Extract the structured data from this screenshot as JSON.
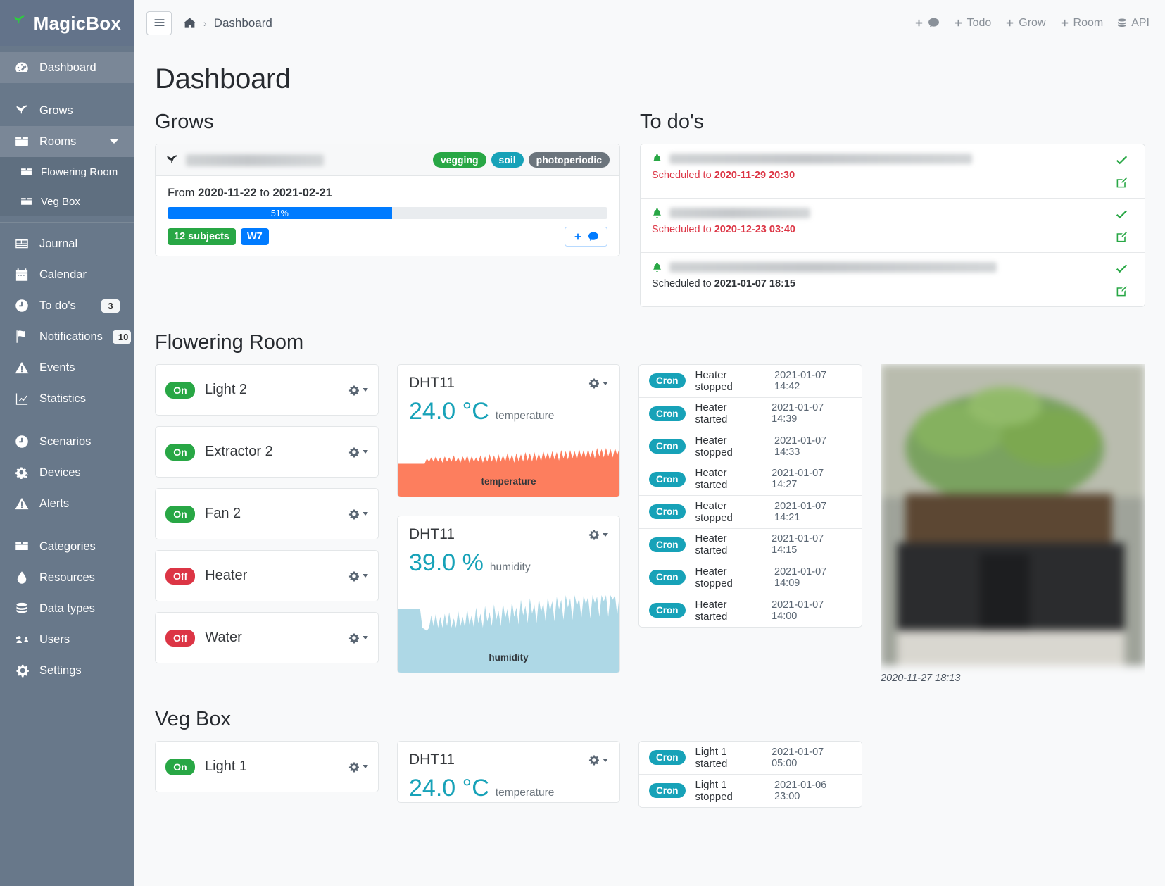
{
  "brand": {
    "name": "MagicBox",
    "logo_icon": "sprout-icon"
  },
  "sidebar": {
    "groups": [
      {
        "items": [
          {
            "label": "Dashboard",
            "icon": "dashboard-icon",
            "active": true
          }
        ]
      },
      {
        "items": [
          {
            "label": "Grows",
            "icon": "sprout-icon"
          },
          {
            "label": "Rooms",
            "icon": "box-icon",
            "expanded": true,
            "children": [
              {
                "label": "Flowering Room",
                "icon": "box-icon"
              },
              {
                "label": "Veg Box",
                "icon": "box-icon"
              }
            ]
          }
        ]
      },
      {
        "items": [
          {
            "label": "Journal",
            "icon": "journal-icon"
          },
          {
            "label": "Calendar",
            "icon": "calendar-icon"
          },
          {
            "label": "To do's",
            "icon": "clock-icon",
            "badge": "3"
          },
          {
            "label": "Notifications",
            "icon": "flag-icon",
            "badge": "10"
          },
          {
            "label": "Events",
            "icon": "warning-icon"
          },
          {
            "label": "Statistics",
            "icon": "chart-line-icon"
          }
        ]
      },
      {
        "items": [
          {
            "label": "Scenarios",
            "icon": "clock-icon"
          },
          {
            "label": "Devices",
            "icon": "cogs-icon"
          },
          {
            "label": "Alerts",
            "icon": "warning-icon"
          }
        ]
      },
      {
        "items": [
          {
            "label": "Categories",
            "icon": "box-icon"
          },
          {
            "label": "Resources",
            "icon": "droplet-icon"
          },
          {
            "label": "Data types",
            "icon": "database-icon"
          },
          {
            "label": "Users",
            "icon": "users-icon"
          },
          {
            "label": "Settings",
            "icon": "gear-icon"
          }
        ]
      }
    ]
  },
  "topbar": {
    "menu_icon": "hamburger-icon",
    "home_icon": "home-icon",
    "separator": "›",
    "breadcrumb": "Dashboard",
    "actions": [
      {
        "label": "",
        "icon": "plus-comment-icon"
      },
      {
        "label": "Todo",
        "icon": "plus-icon"
      },
      {
        "label": "Grow",
        "icon": "plus-icon"
      },
      {
        "label": "Room",
        "icon": "plus-icon"
      },
      {
        "label": "API",
        "icon": "database-icon"
      }
    ]
  },
  "page": {
    "title": "Dashboard"
  },
  "grows": {
    "section_title": "Grows",
    "card": {
      "name_redacted": true,
      "icon": "sprout-icon",
      "tags": [
        {
          "label": "vegging",
          "color": "#28a745"
        },
        {
          "label": "soil",
          "color": "#17a2b8"
        },
        {
          "label": "photoperiodic",
          "color": "#6c757d"
        }
      ],
      "from_label": "From",
      "to_label": "to",
      "date_start": "2020-11-22",
      "date_end": "2021-02-21",
      "progress_percent": 51,
      "progress_label": "51%",
      "subjects_label": "12 subjects",
      "week_label": "W7",
      "action_icons": [
        "plus-icon",
        "comment-icon"
      ]
    }
  },
  "todos": {
    "section_title": "To do's",
    "items": [
      {
        "title_redacted": true,
        "redact_width": 430,
        "scheduled_prefix": "Scheduled to",
        "scheduled_at": "2020-11-29 20:30",
        "overdue": true,
        "icon": "bell-icon",
        "actions": [
          "check-icon",
          "edit-icon"
        ]
      },
      {
        "title_redacted": true,
        "redact_width": 200,
        "scheduled_prefix": "Scheduled to",
        "scheduled_at": "2020-12-23 03:40",
        "overdue": true,
        "icon": "bell-icon",
        "actions": [
          "check-icon",
          "edit-icon"
        ]
      },
      {
        "title_redacted": true,
        "redact_width": 465,
        "scheduled_prefix": "Scheduled to",
        "scheduled_at": "2021-01-07 18:15",
        "overdue": false,
        "icon": "bell-icon",
        "actions": [
          "check-icon",
          "edit-icon"
        ]
      }
    ]
  },
  "rooms": [
    {
      "title": "Flowering Room",
      "devices": [
        {
          "name": "Light 2",
          "state": "On"
        },
        {
          "name": "Extractor 2",
          "state": "On"
        },
        {
          "name": "Fan 2",
          "state": "On"
        },
        {
          "name": "Heater",
          "state": "Off"
        },
        {
          "name": "Water",
          "state": "Off"
        }
      ],
      "sensors": [
        {
          "name": "DHT11",
          "value": "24.0",
          "unit": "°C",
          "metric": "temperature",
          "chart_label": "temperature",
          "color": "#fd7e5e"
        },
        {
          "name": "DHT11",
          "value": "39.0",
          "unit": "%",
          "metric": "humidity",
          "chart_label": "humidity",
          "color": "#aed8e6"
        }
      ],
      "logs": [
        {
          "source": "Cron",
          "message": "Heater stopped",
          "time": "2021-01-07 14:42"
        },
        {
          "source": "Cron",
          "message": "Heater started",
          "time": "2021-01-07 14:39"
        },
        {
          "source": "Cron",
          "message": "Heater stopped",
          "time": "2021-01-07 14:33"
        },
        {
          "source": "Cron",
          "message": "Heater started",
          "time": "2021-01-07 14:27"
        },
        {
          "source": "Cron",
          "message": "Heater stopped",
          "time": "2021-01-07 14:21"
        },
        {
          "source": "Cron",
          "message": "Heater started",
          "time": "2021-01-07 14:15"
        },
        {
          "source": "Cron",
          "message": "Heater stopped",
          "time": "2021-01-07 14:09"
        },
        {
          "source": "Cron",
          "message": "Heater started",
          "time": "2021-01-07 14:00"
        }
      ],
      "photo": {
        "caption": "2020-11-27 18:13",
        "alt": "plant-photo"
      }
    },
    {
      "title": "Veg Box",
      "devices": [
        {
          "name": "Light 1",
          "state": "On"
        }
      ],
      "sensors": [
        {
          "name": "DHT11",
          "value": "24.0",
          "unit": "°C",
          "metric": "temperature",
          "chart_label": "temperature",
          "color": "#fd7e5e"
        }
      ],
      "logs": [
        {
          "source": "Cron",
          "message": "Light 1 started",
          "time": "2021-01-07 05:00"
        },
        {
          "source": "Cron",
          "message": "Light 1 stopped",
          "time": "2021-01-06 23:00"
        }
      ]
    }
  ],
  "chart_data": [
    {
      "type": "area",
      "title": "temperature",
      "ylabel": "°C",
      "current_value": 24.0,
      "series": [
        {
          "name": "temperature",
          "color": "#fd7e5e",
          "values": [
            62,
            62,
            62,
            62,
            62,
            62,
            62,
            62,
            62,
            62,
            62,
            62,
            62,
            72,
            66,
            74,
            66,
            76,
            66,
            74,
            64,
            76,
            66,
            74,
            66,
            78,
            66,
            74,
            64,
            76,
            66,
            78,
            64,
            76,
            66,
            74,
            66,
            78,
            64,
            76,
            66,
            80,
            66,
            78,
            64,
            80,
            66,
            78,
            66,
            82,
            66,
            80,
            64,
            82,
            66,
            80,
            66,
            84,
            68,
            82,
            66,
            84,
            68,
            82,
            66,
            86,
            70,
            84,
            68,
            86,
            70,
            84,
            68,
            88,
            72,
            86,
            70,
            88,
            72,
            86,
            70,
            90,
            74,
            88,
            72,
            90,
            74,
            88,
            72,
            92,
            76,
            90,
            74,
            92,
            76,
            90,
            74,
            92,
            78,
            92
          ]
        }
      ]
    },
    {
      "type": "area",
      "title": "humidity",
      "ylabel": "%",
      "current_value": 39.0,
      "series": [
        {
          "name": "humidity",
          "color": "#aed8e6",
          "values": [
            82,
            82,
            82,
            82,
            82,
            82,
            82,
            82,
            82,
            82,
            82,
            58,
            56,
            54,
            58,
            74,
            60,
            76,
            58,
            72,
            58,
            76,
            60,
            78,
            58,
            70,
            58,
            80,
            60,
            72,
            58,
            82,
            62,
            74,
            58,
            84,
            64,
            76,
            58,
            86,
            66,
            78,
            60,
            88,
            68,
            80,
            60,
            90,
            70,
            82,
            62,
            92,
            72,
            84,
            62,
            94,
            74,
            86,
            64,
            96,
            76,
            88,
            64,
            96,
            78,
            90,
            66,
            98,
            80,
            92,
            66,
            98,
            82,
            94,
            68,
            100,
            84,
            96,
            68,
            100,
            86,
            96,
            70,
            100,
            88,
            98,
            70,
            100,
            90,
            98,
            72,
            100,
            92,
            100,
            72,
            100,
            94,
            100,
            74,
            100
          ]
        }
      ]
    }
  ]
}
